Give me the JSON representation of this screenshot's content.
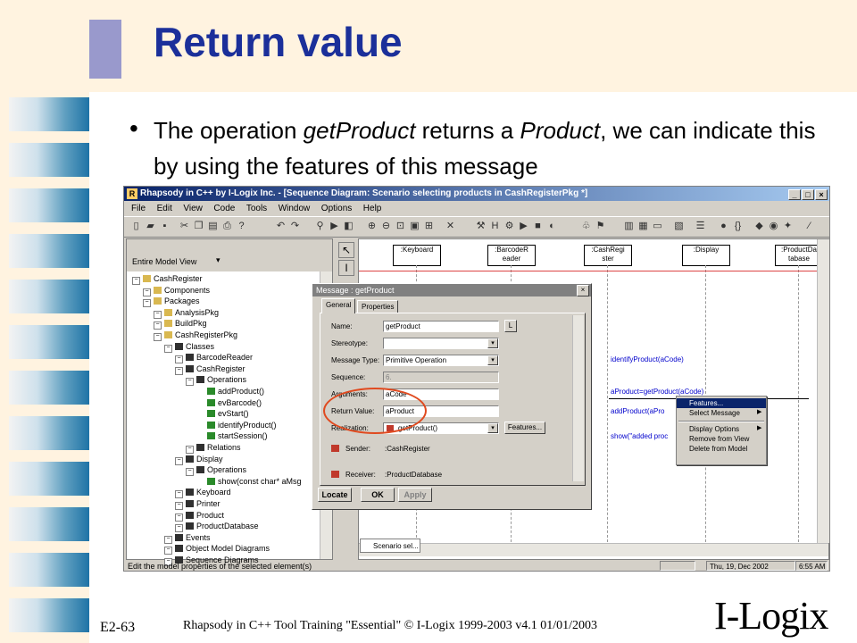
{
  "slide": {
    "title": "Return value",
    "bullet_text_pre": "The operation ",
    "bullet_italic_1": "getProduct",
    "bullet_text_mid": " returns a ",
    "bullet_italic_2": "Product",
    "bullet_text_post": ", we can indicate this by using the features of this message",
    "footer_number": "E2-63",
    "footer_text": "Rhapsody in C++ Tool Training \"Essential\"   © I-Logix 1999-2003   v4.1  01/01/2003",
    "logo_text": "I-Logix"
  },
  "app": {
    "window_title": "Rhapsody in C++ by I-Logix Inc. - [Sequence Diagram: Scenario selecting products in CashRegisterPkg *]",
    "menu": [
      "File",
      "Edit",
      "View",
      "Code",
      "Tools",
      "Window",
      "Options",
      "Help"
    ],
    "model_view_label": "Entire Model View",
    "tree": [
      {
        "label": "CashRegister",
        "depth": 0
      },
      {
        "label": "Components",
        "depth": 1
      },
      {
        "label": "Packages",
        "depth": 1
      },
      {
        "label": "AnalysisPkg",
        "depth": 2
      },
      {
        "label": "BuildPkg",
        "depth": 2
      },
      {
        "label": "CashRegisterPkg",
        "depth": 2
      },
      {
        "label": "Classes",
        "depth": 3
      },
      {
        "label": "BarcodeReader",
        "depth": 4
      },
      {
        "label": "CashRegister",
        "depth": 4
      },
      {
        "label": "Operations",
        "depth": 5
      },
      {
        "label": "addProduct()",
        "depth": 6
      },
      {
        "label": "evBarcode()",
        "depth": 6
      },
      {
        "label": "evStart()",
        "depth": 6
      },
      {
        "label": "identifyProduct()",
        "depth": 6
      },
      {
        "label": "startSession()",
        "depth": 6
      },
      {
        "label": "Relations",
        "depth": 5
      },
      {
        "label": "Display",
        "depth": 4
      },
      {
        "label": "Operations",
        "depth": 5
      },
      {
        "label": "show(const char* aMsg",
        "depth": 6
      },
      {
        "label": "Keyboard",
        "depth": 4
      },
      {
        "label": "Printer",
        "depth": 4
      },
      {
        "label": "Product",
        "depth": 4
      },
      {
        "label": "ProductDatabase",
        "depth": 4
      },
      {
        "label": "Events",
        "depth": 3
      },
      {
        "label": "Object Model Diagrams",
        "depth": 3
      },
      {
        "label": "Sequence Diagrams",
        "depth": 3
      }
    ],
    "lifelines": [
      {
        "label": ":Keyboard"
      },
      {
        "label": ":BarcodeR eader"
      },
      {
        "label": ":CashRegi ster"
      },
      {
        "label": ":Display"
      },
      {
        "label": ":ProductDa tabase"
      }
    ],
    "messages": {
      "m1": "identifyProduct(aCode)",
      "m2": "aProduct=getProduct(aCode)",
      "m3": "addProduct(aPro",
      "m4": "show(\"added proc"
    },
    "context_menu": [
      "Features...",
      "Select Message",
      "Display Options",
      "Remove from View",
      "Delete from Model"
    ],
    "dialog": {
      "title": "Message : getProduct",
      "tabs": [
        "General",
        "Properties"
      ],
      "fields": {
        "name_label": "Name:",
        "name_value": "getProduct",
        "locate_small": "L",
        "stereotype_label": "Stereotype:",
        "stereotype_value": "",
        "msgtype_label": "Message Type:",
        "msgtype_value": "Primitive Operation",
        "sequence_label": "Sequence:",
        "sequence_value": "6.",
        "arguments_label": "Arguments:",
        "arguments_value": "aCode",
        "return_label": "Return Value:",
        "return_value": "aProduct",
        "realization_label": "Realization:",
        "realization_value": "getProduct()",
        "features_button": "Features...",
        "sender_label": "Sender:",
        "sender_value": ":CashRegister",
        "receiver_label": "Receiver:",
        "receiver_value": ":ProductDatabase"
      },
      "buttons": {
        "locate": "Locate",
        "ok": "OK",
        "apply": "Apply"
      }
    },
    "doc_tab": "Scenario sel...",
    "status": {
      "message": "Edit the model properties of the selected element(s)",
      "date": "Thu, 19, Dec 2002",
      "time": "6:55  AM"
    }
  },
  "colors": {
    "title": "#1b2f9a",
    "highlight_circle": "#e04a1f",
    "selection": "#0a246a"
  }
}
